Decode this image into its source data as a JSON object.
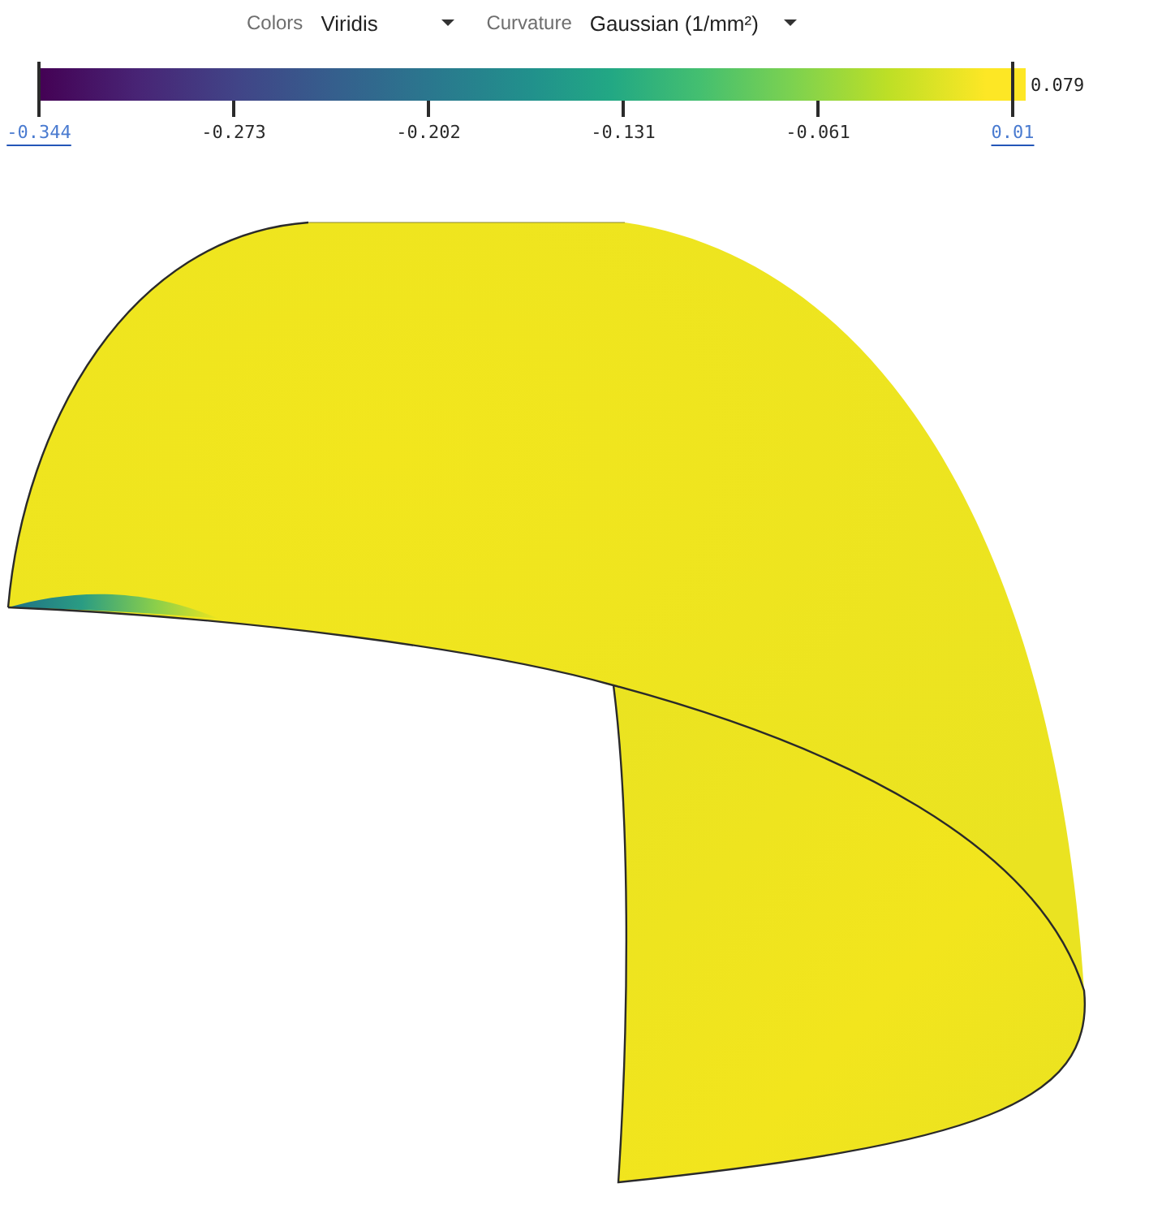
{
  "toolbar": {
    "colors": {
      "label": "Colors",
      "value": "Viridis"
    },
    "curvature": {
      "label": "Curvature",
      "value": "Gaussian (1/mm²)"
    }
  },
  "colorbar": {
    "max_label": "0.079",
    "ticks": [
      {
        "label": "-0.344",
        "kind": "link"
      },
      {
        "label": "-0.273",
        "kind": "plain"
      },
      {
        "label": "-0.202",
        "kind": "plain"
      },
      {
        "label": "-0.131",
        "kind": "plain"
      },
      {
        "label": "-0.061",
        "kind": "plain"
      },
      {
        "label": "0.01",
        "kind": "link"
      }
    ]
  }
}
